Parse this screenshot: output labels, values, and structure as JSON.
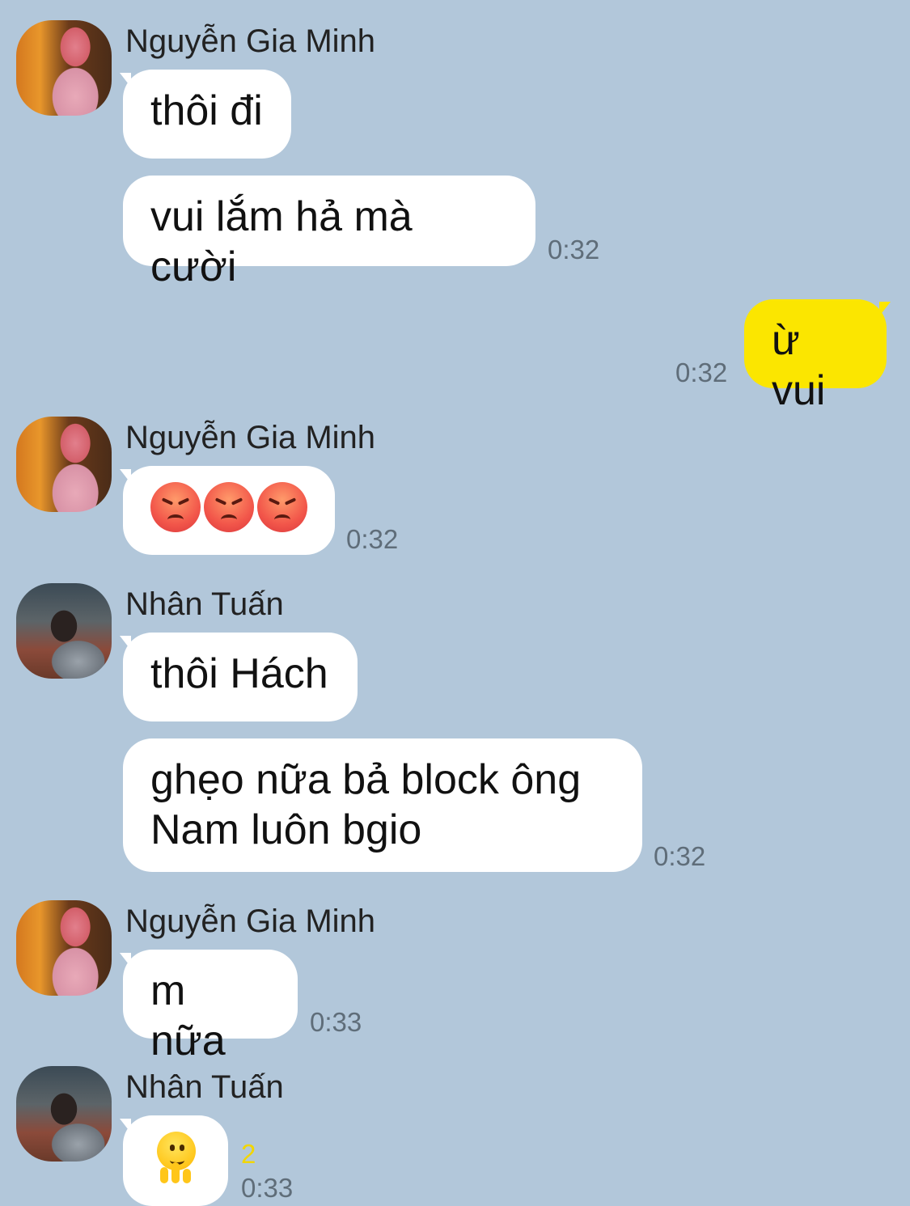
{
  "contacts": {
    "minh": "Nguyễn Gia Minh",
    "tuan": "Nhân Tuấn"
  },
  "messages": {
    "m1": "thôi đi",
    "m2": "vui lắm hả mà cười",
    "m2_time": "0:32",
    "m3": "ừ vui",
    "m3_time": "0:32",
    "m4_emojis": [
      "angry-face",
      "angry-face",
      "angry-face"
    ],
    "m4_time": "0:32",
    "m5": "thôi Hách",
    "m6_line1": "ghẹo nữa bả block ông",
    "m6_line2": "Nam luôn bgio",
    "m6_time": "0:32",
    "m7": "m nữa",
    "m7_time": "0:33",
    "m8_emoji": "melting-face",
    "m8_unread": "2",
    "m8_time": "0:33"
  },
  "colors": {
    "background": "#b2c7da",
    "incoming_bubble": "#ffffff",
    "outgoing_bubble": "#fbe600",
    "unread_count": "#f2d600"
  }
}
